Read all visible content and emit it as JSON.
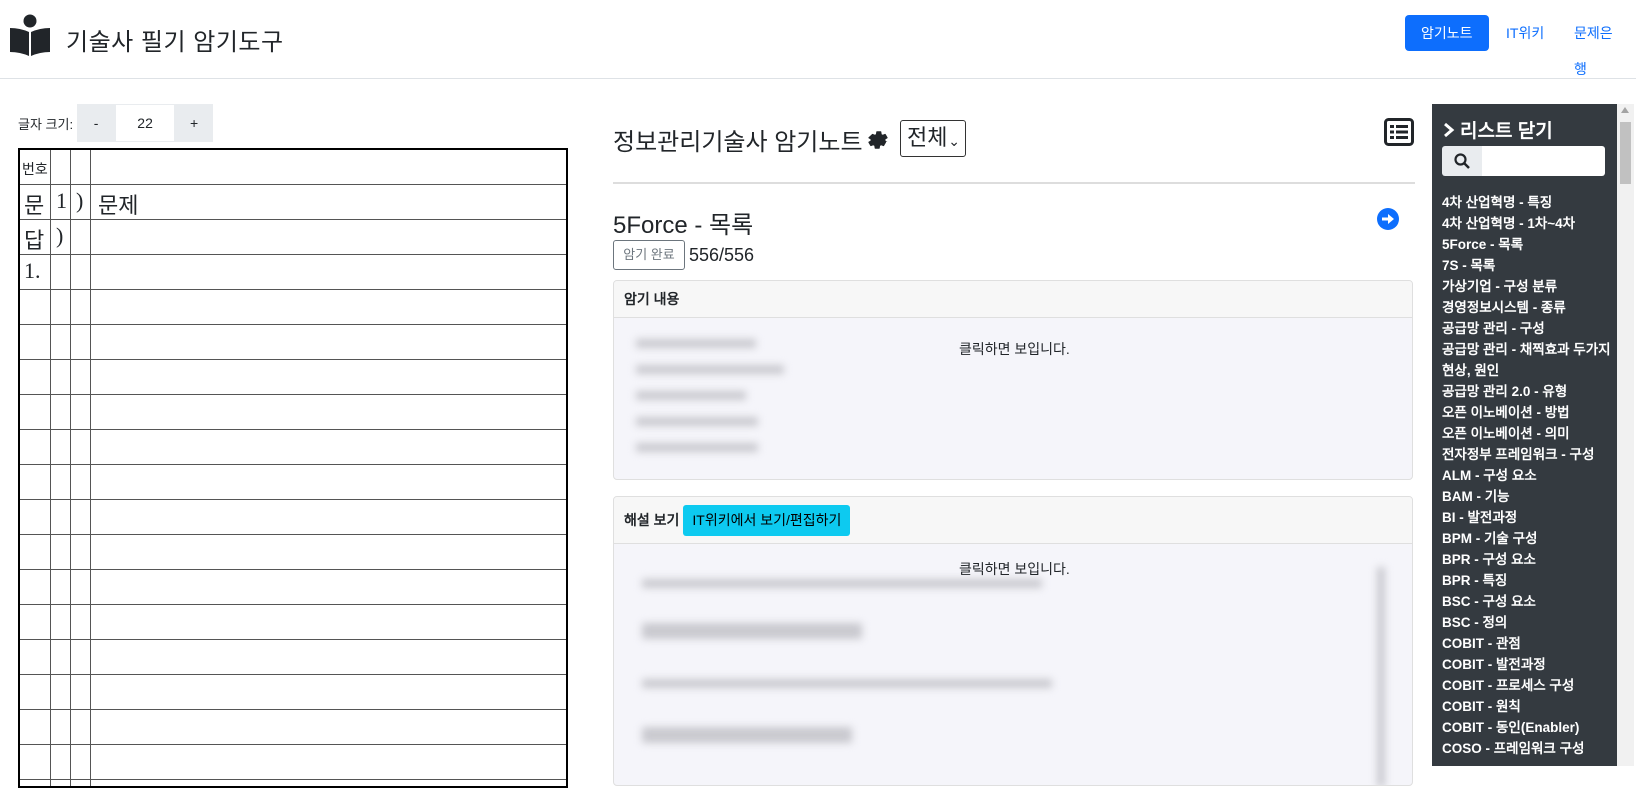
{
  "header": {
    "brand_title": "기술사 필기 암기도구",
    "nav": {
      "notes": "암기노트",
      "wiki": "IT위키",
      "bank": "문제은행"
    }
  },
  "left": {
    "font_size_label": "글자 크기:",
    "minus_label": "-",
    "plus_label": "+",
    "font_size_value": "22",
    "grid": {
      "header_label": "번호",
      "row1": [
        "문",
        "1",
        ")",
        "문제"
      ],
      "row2": [
        "답",
        ")"
      ],
      "row3": [
        "1."
      ]
    }
  },
  "main": {
    "title": "정보관리기술사 암기노트",
    "filter_selected": "전체",
    "item_title": "5Force - 목록",
    "done_button": "암기 완료",
    "progress": "556/556",
    "memo_card": {
      "header": "암기 내용",
      "hint": "클릭하면 보입니다."
    },
    "explain_card": {
      "header": "해설 보기",
      "wiki_button": "IT위키에서 보기/편집하기",
      "hint": "클릭하면 보입니다."
    }
  },
  "sidebar": {
    "toggle_label": "리스트 닫기",
    "items": [
      "4차 산업혁명 - 특징",
      "4차 산업혁명 - 1차~4차",
      "5Force - 목록",
      "7S - 목록",
      "가상기업 - 구성 분류",
      "경영정보시스템 - 종류",
      "공급망 관리 - 구성",
      "공급망 관리 - 채찍효과 두가지 현상, 원인",
      "공급망 관리 2.0 - 유형",
      "오픈 이노베이션 - 방법",
      "오픈 이노베이션 - 의미",
      "전자정부 프레임워크 - 구성",
      "ALM - 구성 요소",
      "BAM - 기능",
      "BI - 발전과정",
      "BPM - 기술 구성",
      "BPR - 구성 요소",
      "BPR - 특징",
      "BSC - 구성 요소",
      "BSC - 정의",
      "COBIT - 관점",
      "COBIT - 발전과정",
      "COBIT - 프로세스 구성",
      "COBIT - 원칙",
      "COBIT - 동인(Enabler)",
      "COSO - 프레임워크 구성"
    ]
  },
  "colors": {
    "primary": "#0d6efd",
    "info": "#0dcaf0",
    "sidebar_bg": "#343a40"
  }
}
